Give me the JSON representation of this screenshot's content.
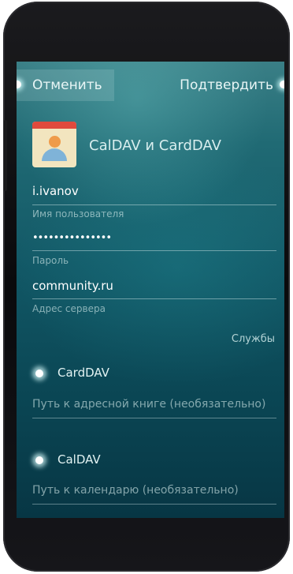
{
  "header": {
    "cancel_label": "Отменить",
    "confirm_label": "Подтвердить"
  },
  "account": {
    "title": "CalDAV и CardDAV",
    "icon": "contacts-calendar-app-icon"
  },
  "fields": {
    "username": {
      "value": "i.ivanov",
      "label": "Имя пользователя"
    },
    "password": {
      "value": "•••••••••••••••",
      "label": "Пароль"
    },
    "server": {
      "value": "community.ru",
      "label": "Адрес сервера"
    }
  },
  "services": {
    "heading": "Службы",
    "carddav": {
      "label": "CardDAV",
      "enabled": true,
      "path_placeholder": "Путь к адресной книге (необязательно)"
    },
    "caldav": {
      "label": "CalDAV",
      "enabled": true,
      "path_placeholder": "Путь к календарю (необязательно)"
    }
  },
  "colors": {
    "accent_glow": "#dfffff",
    "background_top": "#3a7f86",
    "background_bottom": "#073644",
    "icon_red": "#e04a3d",
    "icon_orange": "#ef9b4a",
    "icon_blue": "#7fb3d8"
  }
}
